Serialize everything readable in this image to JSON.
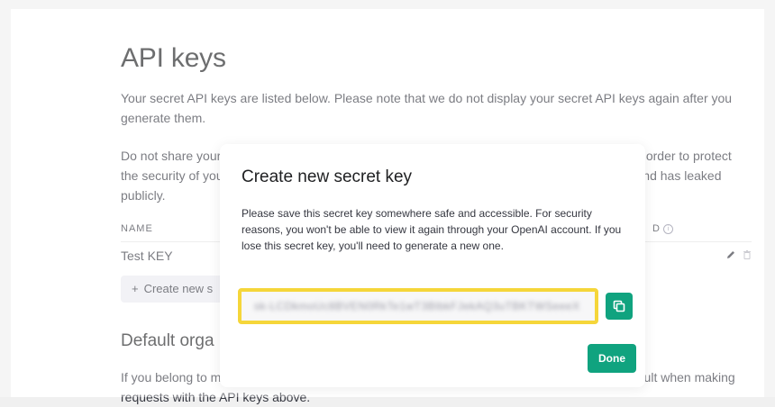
{
  "page": {
    "title": "API keys",
    "intro_1": "Your secret API keys are listed below. Please note that we do not display your secret API keys again after you generate them.",
    "intro_2": "Do not share your API key with others, or expose it in the browser or other client-side code. In order to protect the security of your account, OpenAI may also automatically rotate any API key that we've found has leaked publicly."
  },
  "table": {
    "headers": [
      "NAME",
      "D"
    ],
    "rows": [
      {
        "name": "Test KEY"
      }
    ]
  },
  "create_button": {
    "icon": "plus-icon",
    "label": "Create new s"
  },
  "default_org": {
    "heading": "Default orga",
    "text": "If you belong to multiple organizations, this setting controls which organization is used by default when making requests with the API keys above."
  },
  "modal": {
    "title": "Create new secret key",
    "body": "Please save this secret key somewhere safe and accessible. For security reasons, you won't be able to view it again through your OpenAI account. If you lose this secret key, you'll need to generate a new one.",
    "secret_key": "sk-LCDkmoUc8BVEN0RkTe1wT3BlbkFJekAQ3uTBKTWSeeeX",
    "copy_icon": "copy-icon",
    "done_label": "Done"
  },
  "colors": {
    "accent": "#10a37f",
    "highlight": "#f5d63a"
  }
}
